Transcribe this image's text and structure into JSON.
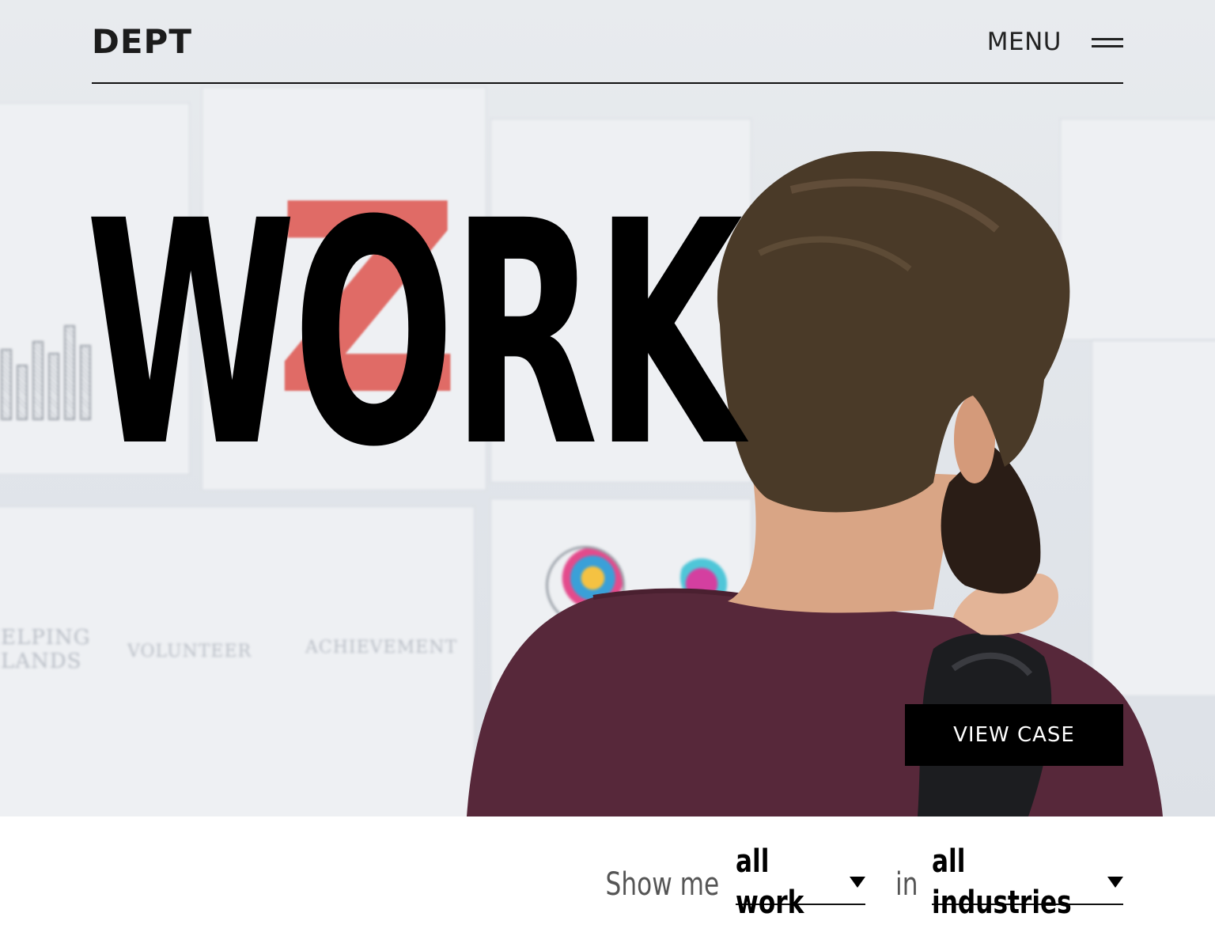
{
  "header": {
    "logo": "DEPT",
    "menu_label": "MENU"
  },
  "hero": {
    "headline": "WORK",
    "cta_label": "VIEW CASE"
  },
  "filter": {
    "prefix": "Show me",
    "work_value": "all work",
    "connector": "in",
    "industry_value": "all industries"
  },
  "colors": {
    "accent": "#000000",
    "background": "#ffffff",
    "shirt": "#5a2a35",
    "hair": "#4a3a28"
  },
  "icons": {
    "menu": "hamburger-icon",
    "dropdown": "caret-down-icon"
  }
}
